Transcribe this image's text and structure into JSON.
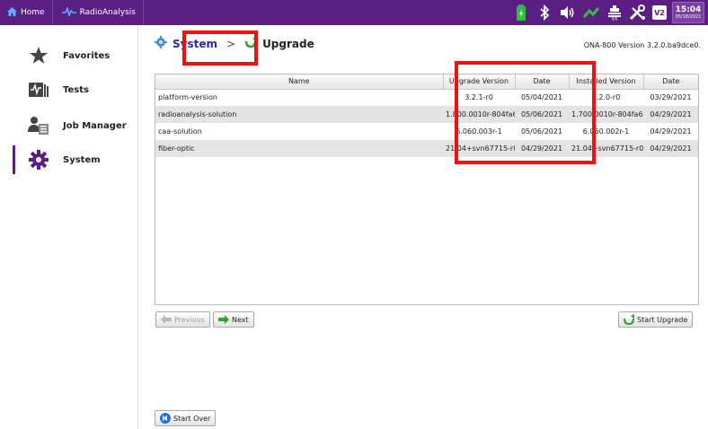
{
  "topbar": {
    "home_label": "Home",
    "app_label": "RadioAnalysis",
    "clock_time": "15:04",
    "clock_date": "05/18/2021",
    "v_badge": "V2",
    "colors": {
      "bar": "#5b1e82",
      "battery": "#2fbf3f"
    }
  },
  "sidebar": {
    "items": [
      {
        "label": "Favorites",
        "icon": "star-icon"
      },
      {
        "label": "Tests",
        "icon": "tests-icon"
      },
      {
        "label": "Job Manager",
        "icon": "job-manager-icon"
      },
      {
        "label": "System",
        "icon": "gear-icon",
        "active": true
      }
    ]
  },
  "breadcrumb": {
    "system": "System",
    "separator": ">",
    "upgrade": "Upgrade"
  },
  "version_text": "ONA-800 Version 3.2.0.ba9dce0.",
  "table": {
    "columns": [
      "Name",
      "Upgrade Version",
      "Date",
      "Installed Version",
      "Date"
    ],
    "rows": [
      [
        "platform-version",
        "3.2.1-r0",
        "05/04/2021",
        "3.2.0-r0",
        "03/29/2021"
      ],
      [
        "radioanalysis-solution",
        "1.800.0010r-804fa66",
        "05/06/2021",
        "1.700.0010r-804fa66",
        "04/29/2021"
      ],
      [
        "caa-solution",
        "6.060.003r-1",
        "05/06/2021",
        "6.060.002r-1",
        "04/29/2021"
      ],
      [
        "fiber-optic",
        "21.04+svn67715-r0",
        "04/29/2021",
        "21.04+svn67715-r0",
        "04/29/2021"
      ]
    ]
  },
  "buttons": {
    "previous": "Previous",
    "next": "Next",
    "start_upgrade": "Start Upgrade",
    "start_over": "Start Over"
  }
}
